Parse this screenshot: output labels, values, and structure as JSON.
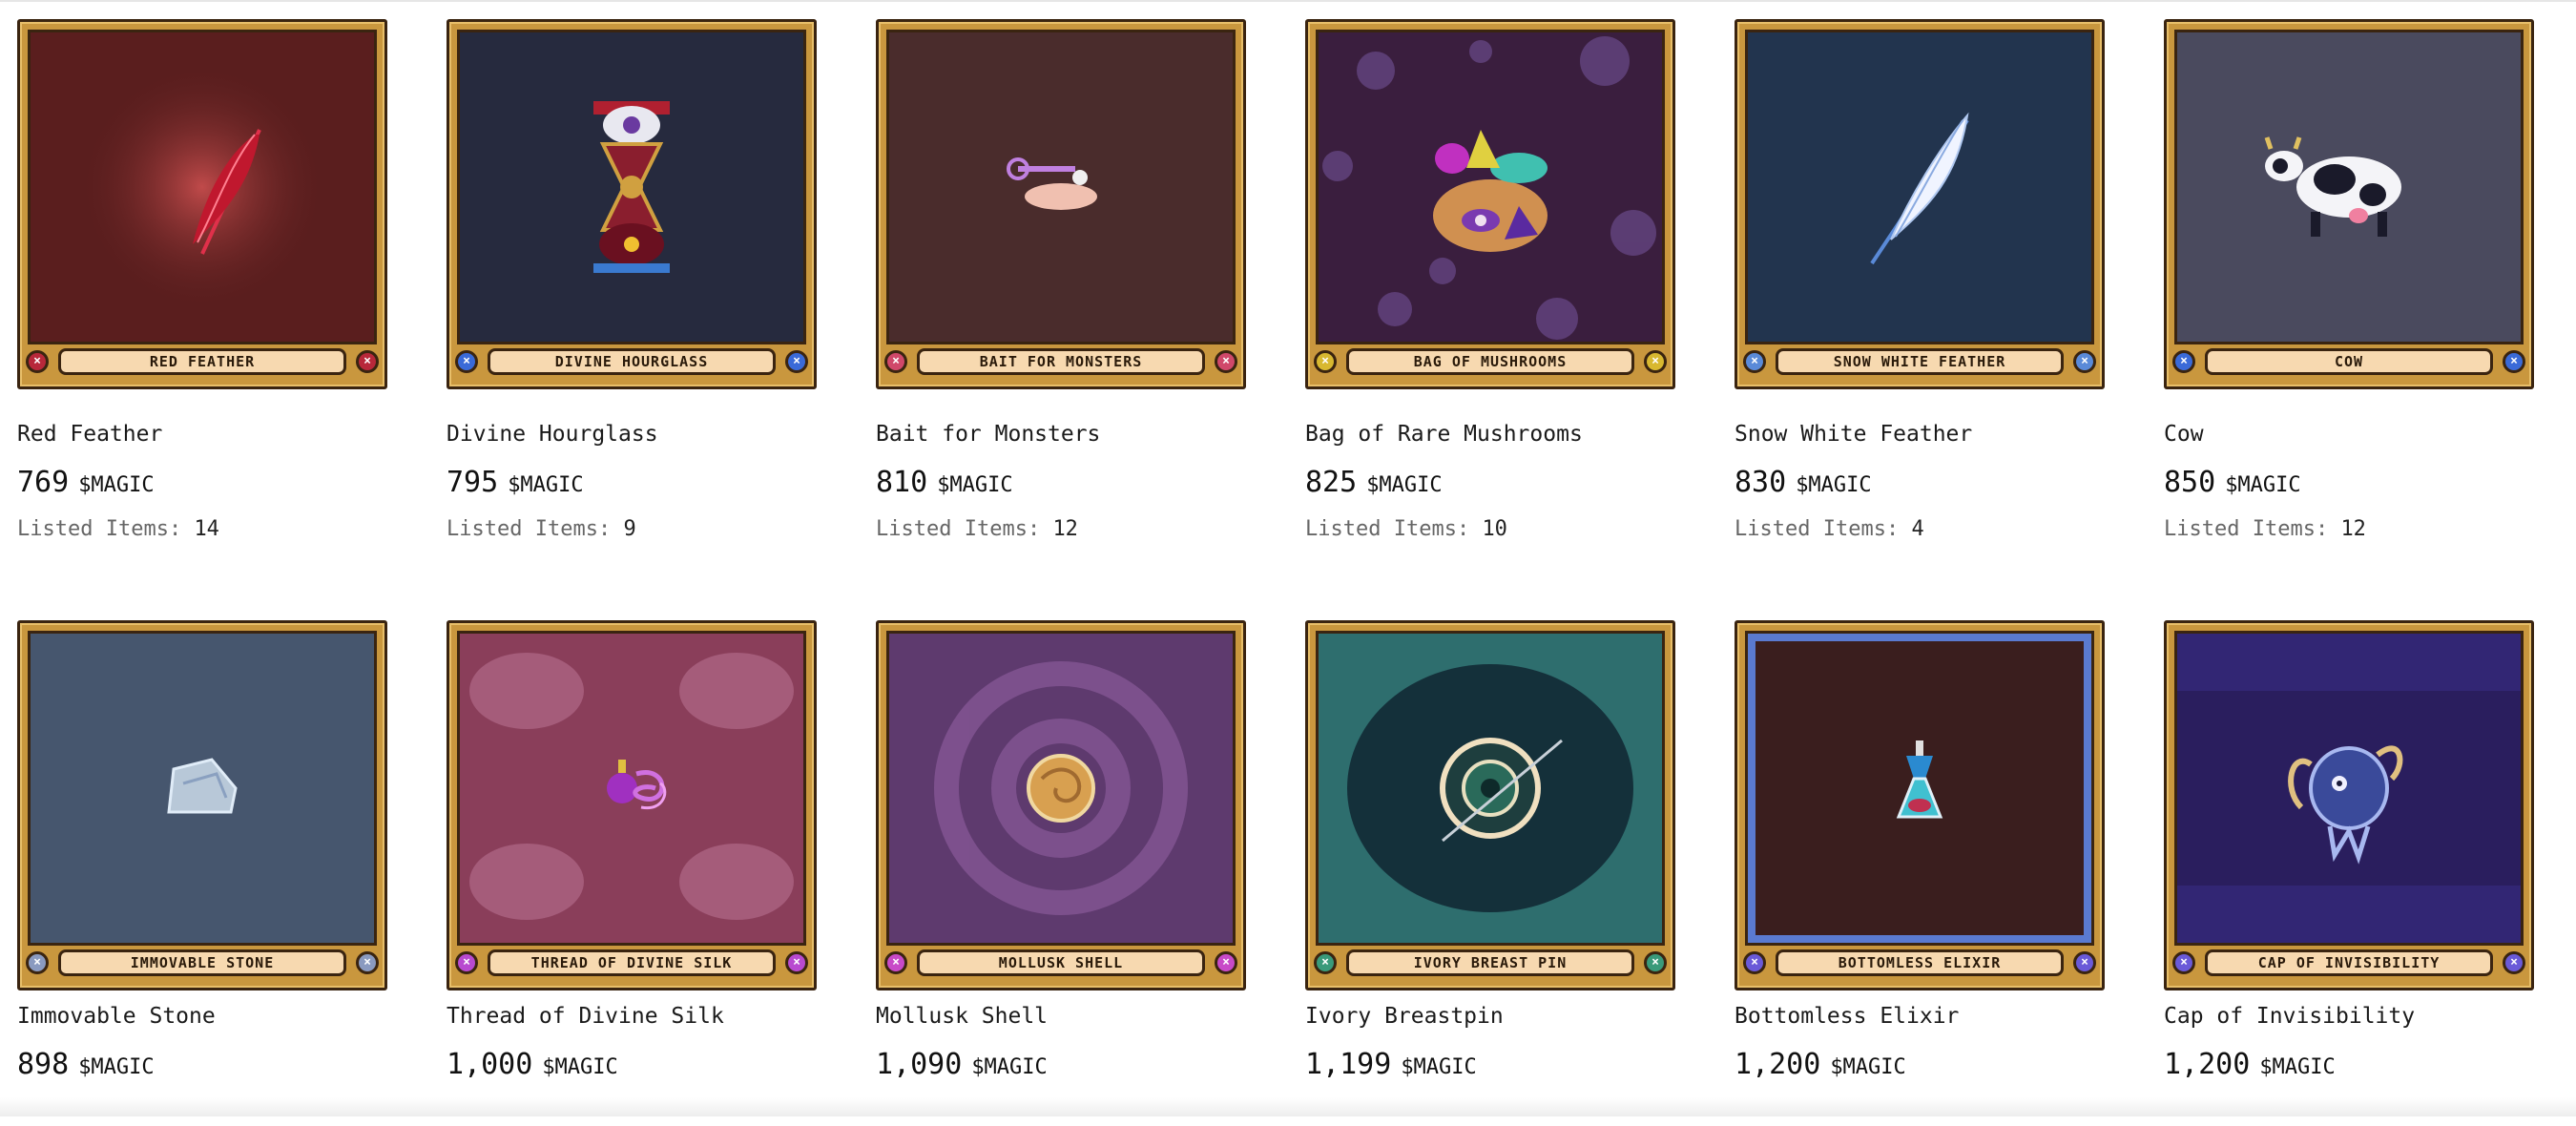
{
  "listed_label": "Listed Items:",
  "currency": "$MAGIC",
  "items": [
    {
      "banner": "Red Feather",
      "title": "Red Feather",
      "price": "769",
      "listed": "14",
      "art_bg": "#5a1e1e",
      "gem": "#b8283a",
      "icon": "red-feather-icon"
    },
    {
      "banner": "Divine Hourglass",
      "title": "Divine Hourglass",
      "price": "795",
      "listed": "9",
      "art_bg": "#262a3e",
      "gem": "#3a6ad8",
      "icon": "hourglass-icon"
    },
    {
      "banner": "Bait for Monsters",
      "title": "Bait for Monsters",
      "price": "810",
      "listed": "12",
      "art_bg": "#4a2c2c",
      "gem": "#d0486a",
      "icon": "bait-icon"
    },
    {
      "banner": "Bag of Mushrooms",
      "title": "Bag of Rare Mushrooms",
      "price": "825",
      "listed": "10",
      "art_bg": "#3a1e3e",
      "gem": "#d8b830",
      "icon": "mushroom-bag-icon"
    },
    {
      "banner": "Snow White Feather",
      "title": "Snow White Feather",
      "price": "830",
      "listed": "4",
      "art_bg": "#22344e",
      "gem": "#5a8ad8",
      "icon": "white-feather-icon"
    },
    {
      "banner": "Cow",
      "title": "Cow",
      "price": "850",
      "listed": "12",
      "art_bg": "#4a4a5e",
      "gem": "#3a6ad8",
      "icon": "cow-icon"
    },
    {
      "banner": "Immovable Stone",
      "title": "Immovable Stone",
      "price": "898",
      "listed": null,
      "art_bg": "#46566e",
      "gem": "#8a9ac0",
      "icon": "stone-icon"
    },
    {
      "banner": "Thread of Divine Silk",
      "title": "Thread of Divine Silk",
      "price": "1,000",
      "listed": null,
      "art_bg": "#8a3e5a",
      "gem": "#b84ad0",
      "icon": "silk-thread-icon"
    },
    {
      "banner": "Mollusk Shell",
      "title": "Mollusk Shell",
      "price": "1,090",
      "listed": null,
      "art_bg": "#5e3a6e",
      "gem": "#c84ac8",
      "icon": "shell-icon"
    },
    {
      "banner": "Ivory Breast Pin",
      "title": "Ivory Breastpin",
      "price": "1,199",
      "listed": null,
      "art_bg": "#1e4a4e",
      "gem": "#3a9a7a",
      "icon": "breastpin-icon"
    },
    {
      "banner": "Bottomless Elixir",
      "title": "Bottomless Elixir",
      "price": "1,200",
      "listed": null,
      "art_bg": "#3a1e1e",
      "gem": "#6a5ad8",
      "icon": "elixir-icon"
    },
    {
      "banner": "Cap of Invisibility",
      "title": "Cap of Invisibility",
      "price": "1,200",
      "listed": null,
      "art_bg": "#2a1e5e",
      "gem": "#6a5ad8",
      "icon": "cap-icon"
    }
  ]
}
